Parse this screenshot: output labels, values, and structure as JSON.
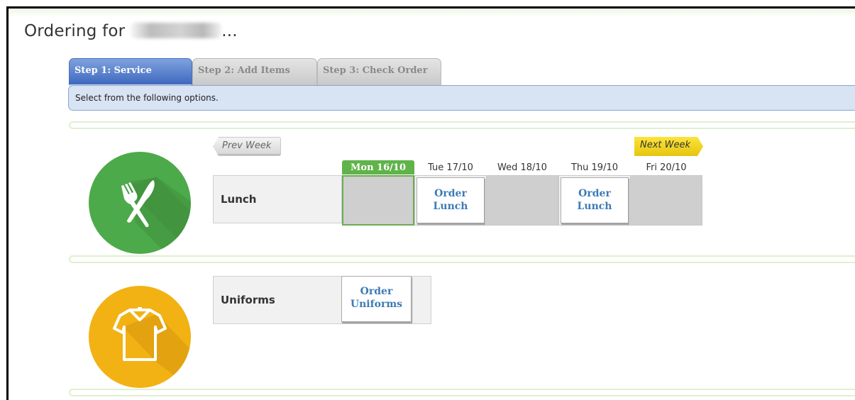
{
  "heading": {
    "prefix": "Ordering for",
    "suffix": "..."
  },
  "steps": [
    {
      "label": "Step 1: Service",
      "active": true
    },
    {
      "label": "Step 2: Add Items",
      "active": false
    },
    {
      "label": "Step 3: Check Order",
      "active": false
    }
  ],
  "instructions": "Select from the following options.",
  "week_nav": {
    "prev": "Prev Week",
    "next": "Next Week"
  },
  "days": [
    {
      "label": "Mon 16/10",
      "current": true
    },
    {
      "label": "Tue 17/10",
      "current": false
    },
    {
      "label": "Wed 18/10",
      "current": false
    },
    {
      "label": "Thu 19/10",
      "current": false
    },
    {
      "label": "Fri 20/10",
      "current": false
    }
  ],
  "services": {
    "lunch": {
      "label": "Lunch",
      "icon": "cutlery-icon",
      "order_line1": "Order",
      "order_line2": "Lunch"
    },
    "uniforms": {
      "label": "Uniforms",
      "icon": "shirt-icon",
      "order_line1": "Order",
      "order_line2": "Uniforms"
    }
  },
  "colors": {
    "active_tab": "#3d67bd",
    "lunch_circle": "#4daa4a",
    "uniforms_circle": "#f2b214",
    "next_week": "#f5d824",
    "current_day": "#5fb34a",
    "order_text": "#3d7bb5"
  }
}
